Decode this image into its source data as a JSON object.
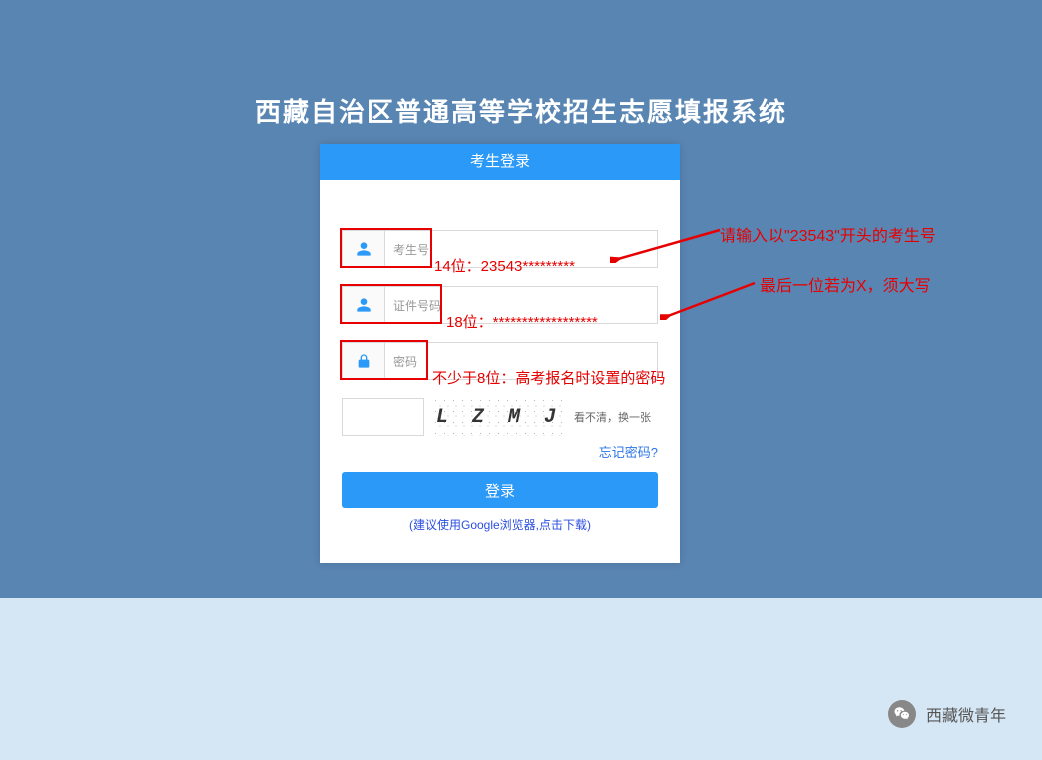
{
  "page": {
    "title": "西藏自治区普通高等学校招生志愿填报系统"
  },
  "login": {
    "header": "考生登录",
    "fields": {
      "candidate": {
        "label": "考生号",
        "placeholder": ""
      },
      "id": {
        "label": "证件号码",
        "placeholder": ""
      },
      "password": {
        "label": "密码",
        "placeholder": ""
      }
    },
    "captcha": {
      "text": "L Z M J",
      "refresh": "看不清，换一张"
    },
    "forgot": "忘记密码?",
    "submit": "登录",
    "browserHint": "(建议使用Google浏览器,点击下载)"
  },
  "annotations": {
    "candidate_hint": "14位：23543*********",
    "id_hint": "18位：******************",
    "password_hint": "不少于8位：高考报名时设置的密码",
    "outer1": "请输入以\"23543\"开头的考生号",
    "outer2": "最后一位若为X，须大写"
  },
  "footer": {
    "brand": "西藏微青年"
  }
}
